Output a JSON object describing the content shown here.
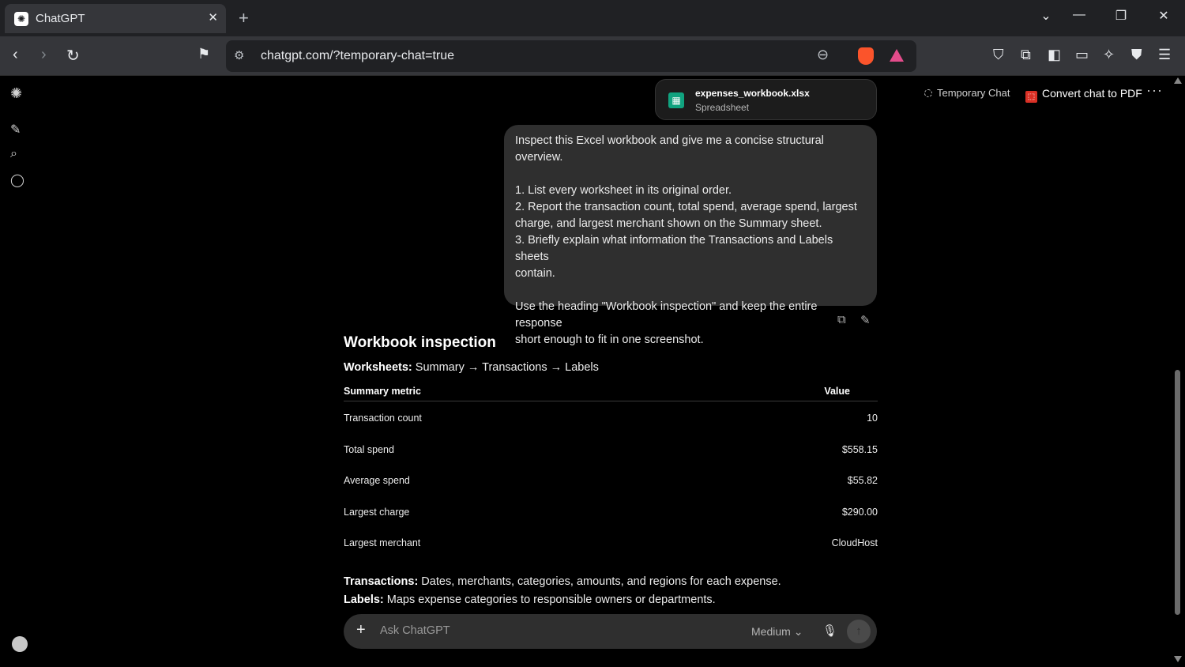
{
  "browser": {
    "tab_title": "ChatGPT",
    "tab_favicon_icon": "openai-logo-icon",
    "url": "chatgpt.com/?temporary-chat=true"
  },
  "sidebar": {
    "icons": [
      "openai-logo-icon",
      "new-chat-icon",
      "search-icon",
      "chat-bubble-icon"
    ]
  },
  "header": {
    "temporary_chat_label": "Temporary Chat",
    "convert_pdf_label": "Convert chat to PDF"
  },
  "attachment": {
    "file_name": "expenses_workbook.xlsx",
    "file_type": "Spreadsheet"
  },
  "user_message": {
    "text": "Inspect this Excel workbook and give me a concise structural overview.\n\n1. List every worksheet in its original order.\n2. Report the transaction count, total spend, average spend, largest\ncharge, and largest merchant shown on the Summary sheet.\n3. Briefly explain what information the Transactions and Labels sheets\ncontain.\n\nUse the heading \"Workbook inspection\" and keep the entire response\nshort enough to fit in one screenshot."
  },
  "response": {
    "heading": "Workbook inspection",
    "worksheets_label": "Worksheets:",
    "worksheets_value": " Summary → Transactions → Labels",
    "table": {
      "headers": [
        "Summary metric",
        "Value"
      ],
      "rows": [
        [
          "Transaction count",
          "10"
        ],
        [
          "Total spend",
          "$558.15"
        ],
        [
          "Average spend",
          "$55.82"
        ],
        [
          "Largest charge",
          "$290.00"
        ],
        [
          "Largest merchant",
          "CloudHost"
        ]
      ]
    },
    "transactions_label": "Transactions:",
    "transactions_value": " Dates, merchants, categories, amounts, and regions for each expense.",
    "labels_label": "Labels:",
    "labels_value": " Maps expense categories to responsible owners or departments."
  },
  "composer": {
    "placeholder": "Ask ChatGPT",
    "model_label": "Medium"
  },
  "colors": {
    "background": "#000000",
    "bubble": "#2f2f2f",
    "browser_chrome": "#35363a",
    "spreadsheet_icon": "#10a37f",
    "pdf_icon": "#d93025"
  }
}
